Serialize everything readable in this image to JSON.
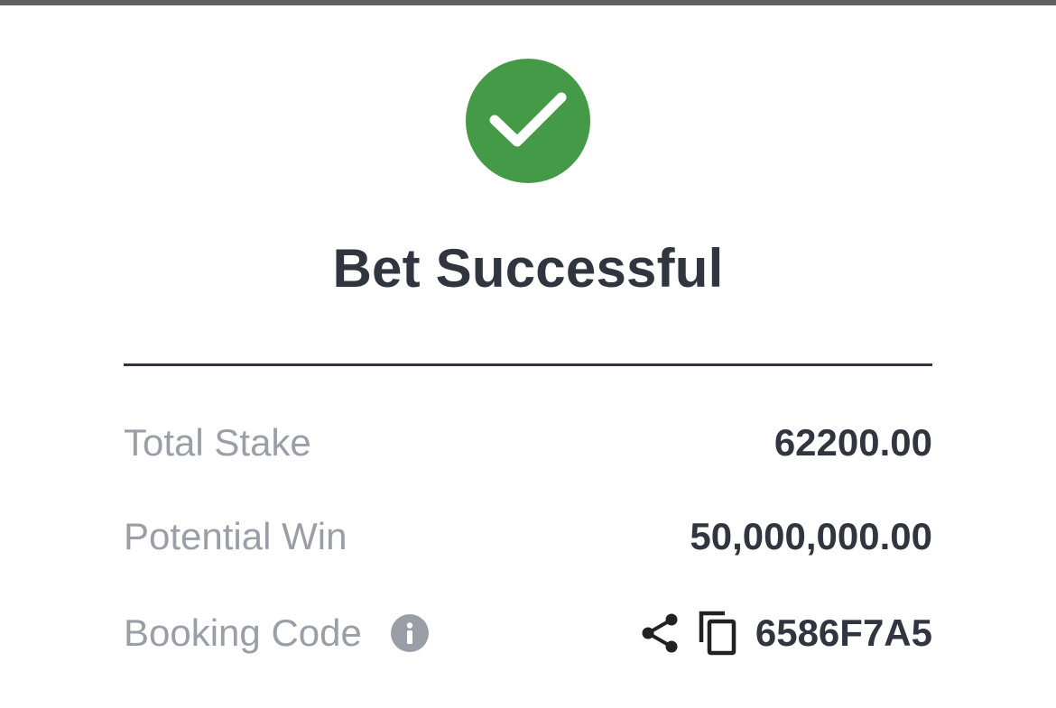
{
  "colors": {
    "success": "#459a47",
    "text_dark": "#303540",
    "text_muted": "#9a9ea6"
  },
  "header": {
    "status_icon": "checkmark-circle-icon",
    "title": "Bet Successful"
  },
  "summary": {
    "total_stake": {
      "label": "Total Stake",
      "value": "62200.00"
    },
    "potential_win": {
      "label": "Potential Win",
      "value": "50,000,000.00"
    },
    "booking_code": {
      "label": "Booking Code",
      "info_icon": "info-icon",
      "share_icon": "share-icon",
      "copy_icon": "copy-icon",
      "value": "6586F7A5"
    }
  }
}
